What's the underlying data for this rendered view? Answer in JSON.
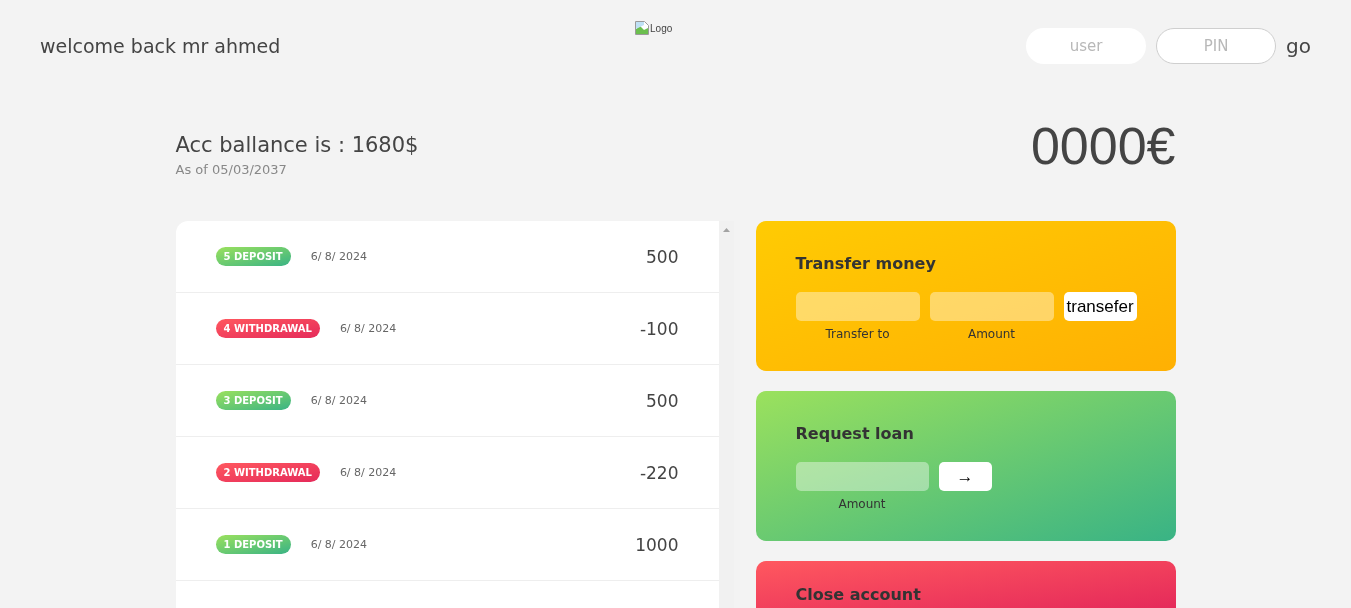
{
  "header": {
    "greeting": "welcome back mr ahmed",
    "logo": {
      "alt": "Logo"
    },
    "login": {
      "fields": [
        {
          "placeholder": "user",
          "focused": false
        },
        {
          "placeholder": "PIN",
          "focused": true
        }
      ],
      "button": "go"
    }
  },
  "balance": {
    "label": "Acc ballance is : 1680$",
    "date": "As of 05/03/2037",
    "total": "0000€"
  },
  "movements": [
    {
      "kind": "deposit",
      "label": "5 DEPOSIT",
      "date": "6/ 8/ 2024",
      "value": "500"
    },
    {
      "kind": "withdrawal",
      "label": "4 WITHDRAWAL",
      "date": "6/ 8/ 2024",
      "value": "-100"
    },
    {
      "kind": "deposit",
      "label": "3 DEPOSIT",
      "date": "6/ 8/ 2024",
      "value": "500"
    },
    {
      "kind": "withdrawal",
      "label": "2 WITHDRAWAL",
      "date": "6/ 8/ 2024",
      "value": "-220"
    },
    {
      "kind": "deposit",
      "label": "1 DEPOSIT",
      "date": "6/ 8/ 2024",
      "value": "1000"
    }
  ],
  "operations": [
    {
      "kind": "transfer",
      "title": "Transfer money",
      "fields": [
        {
          "label": "Transfer to"
        },
        {
          "label": "Amount"
        }
      ],
      "button": "transefer"
    },
    {
      "kind": "loan",
      "title": "Request loan",
      "fields": [
        {
          "label": "Amount"
        }
      ],
      "button": "→"
    },
    {
      "kind": "close",
      "title": "Close account"
    }
  ]
}
